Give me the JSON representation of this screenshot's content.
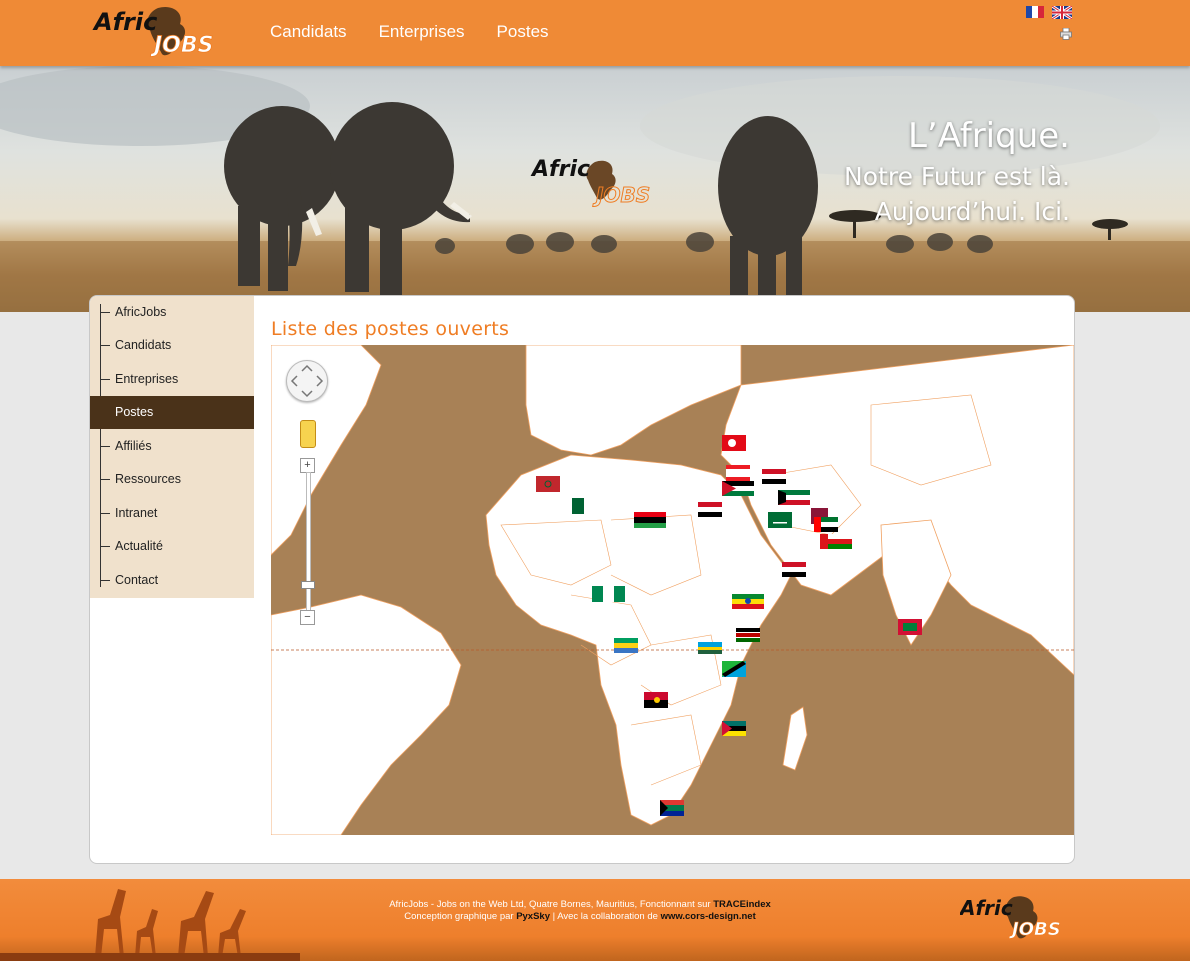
{
  "brand": {
    "logo_alt": "AfricJobs",
    "logo_word": "Afric",
    "logo_tail": "JOBS"
  },
  "nav": {
    "items": [
      {
        "label": "Candidats"
      },
      {
        "label": "Enterprises"
      },
      {
        "label": "Postes"
      }
    ]
  },
  "languages": [
    "fr-flag-icon",
    "uk-flag-icon"
  ],
  "banner": {
    "line1": "L’Afrique.",
    "line2": "Notre Futur est là.",
    "line3": "Aujourd’hui. Ici."
  },
  "sidebar": {
    "items": [
      {
        "label": "AfricJobs",
        "active": false
      },
      {
        "label": "Candidats",
        "active": false
      },
      {
        "label": "Entreprises",
        "active": false
      },
      {
        "label": "Postes",
        "active": true
      },
      {
        "label": "Affiliés",
        "active": false
      },
      {
        "label": "Ressources",
        "active": false
      },
      {
        "label": "Intranet",
        "active": false
      },
      {
        "label": "Actualité",
        "active": false
      },
      {
        "label": "Contact",
        "active": false
      }
    ]
  },
  "main": {
    "title": "Liste des postes ouverts",
    "map_controls": {
      "zoom_in": "+",
      "zoom_out": "−"
    },
    "flags": [
      "morocco",
      "algeria",
      "libya",
      "egypt",
      "turkey",
      "lebanon",
      "jordan",
      "iraq",
      "kuwait",
      "saudi-arabia",
      "palestine",
      "qatar",
      "uae",
      "oman",
      "yemen",
      "nigeria",
      "ethiopia",
      "kenya",
      "gabon",
      "rwanda",
      "tanzania",
      "angola",
      "mozambique",
      "south-africa",
      "maldives"
    ]
  },
  "footer": {
    "line1_prefix": "AfricJobs - Jobs on the Web Ltd, Quatre Bornes, Mauritius, Fonctionnant sur ",
    "line1_brand": "TRACEindex",
    "line2_prefix": "Conception graphique par ",
    "line2_designer": "PyxSky",
    "line2_mid": " | Avec la collaboration de ",
    "line2_site": "www.cors-design.net"
  },
  "colors": {
    "header_orange": "#ef8a36",
    "accent_orange": "#ef7d24",
    "sidebar_bg": "#f0e1cc",
    "sidebar_active": "#4a3219",
    "map_water": "#a88156"
  }
}
